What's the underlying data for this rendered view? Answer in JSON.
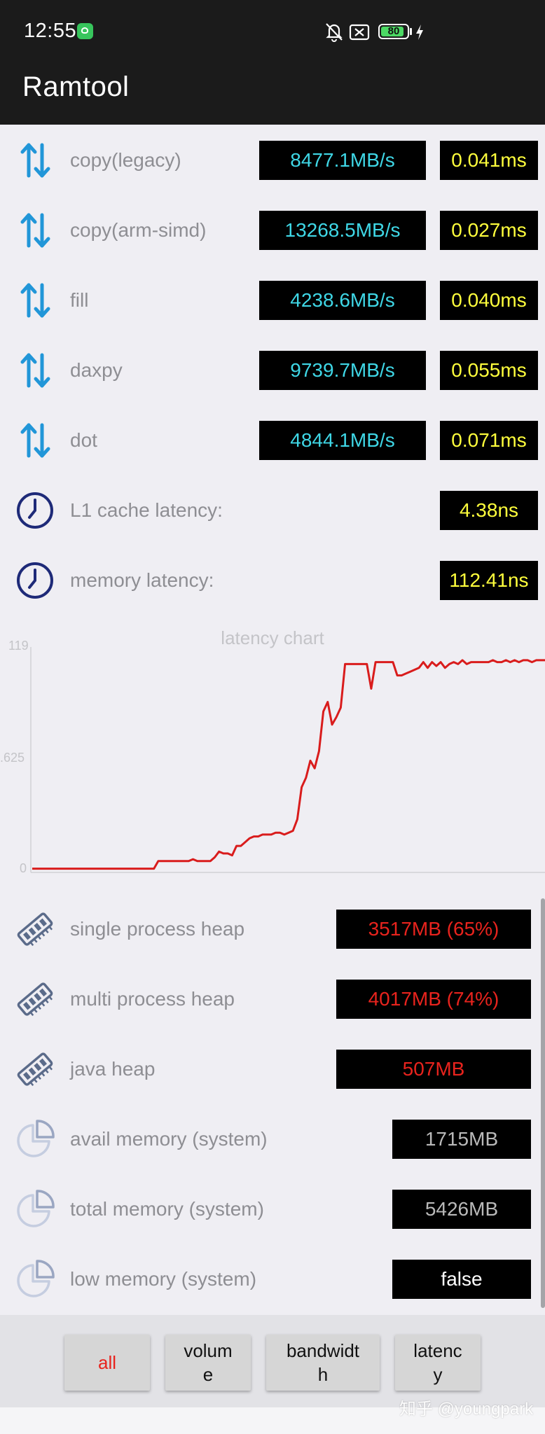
{
  "status": {
    "time": "12:55",
    "battery": "80"
  },
  "app": {
    "title": "Ramtool"
  },
  "bandwidth": [
    {
      "label": "copy(legacy)",
      "speed": "8477.1MB/s",
      "time": "0.041ms"
    },
    {
      "label": "copy(arm-simd)",
      "speed": "13268.5MB/s",
      "time": "0.027ms"
    },
    {
      "label": "fill",
      "speed": "4238.6MB/s",
      "time": "0.040ms"
    },
    {
      "label": "daxpy",
      "speed": "9739.7MB/s",
      "time": "0.055ms"
    },
    {
      "label": "dot",
      "speed": "4844.1MB/s",
      "time": "0.071ms"
    }
  ],
  "latency": [
    {
      "label": "L1 cache latency:",
      "value": "4.38ns"
    },
    {
      "label": "memory latency:",
      "value": "112.41ns"
    }
  ],
  "chart_data": {
    "type": "line",
    "title": "latency chart",
    "y_ticks": [
      "0",
      ".625",
      "119"
    ],
    "ylim": [
      0,
      119
    ],
    "color": "#d91c1c",
    "values": [
      2,
      2,
      2,
      2,
      2,
      2,
      2,
      2,
      2,
      2,
      2,
      2,
      2,
      2,
      2,
      2,
      2,
      2,
      2,
      2,
      2,
      2,
      2,
      2,
      2,
      2,
      2,
      2,
      2,
      6,
      6,
      6,
      6,
      6,
      6,
      6,
      6,
      7,
      6,
      6,
      6,
      6,
      8,
      11,
      10,
      10,
      9,
      14,
      14,
      16,
      18,
      19,
      19,
      20,
      20,
      20,
      21,
      21,
      20,
      21,
      22,
      28,
      45,
      50,
      59,
      55,
      64,
      85,
      90,
      78,
      82,
      87,
      110,
      110,
      110,
      110,
      110,
      110,
      97,
      111,
      111,
      111,
      111,
      111,
      104,
      104,
      105,
      106,
      107,
      108,
      111,
      108,
      111,
      109,
      111,
      108,
      110,
      111,
      110,
      112,
      110,
      111,
      111,
      111,
      111,
      111,
      112,
      111,
      111,
      112,
      111,
      112,
      111,
      112,
      112,
      111,
      112,
      112,
      112
    ]
  },
  "memory": [
    {
      "label": "single process heap",
      "value": "3517MB (65%)"
    },
    {
      "label": "multi process heap",
      "value": "4017MB (74%)"
    },
    {
      "label": "java heap",
      "value": "507MB"
    },
    {
      "label": "avail memory (system)",
      "value": "1715MB"
    },
    {
      "label": "total memory (system)",
      "value": "5426MB"
    },
    {
      "label": "low memory (system)",
      "value": "false"
    }
  ],
  "tabs": [
    {
      "label": "all",
      "active": true
    },
    {
      "label": "volum\ne"
    },
    {
      "label": "bandwidt\nh"
    },
    {
      "label": "latenc\ny"
    }
  ],
  "watermark": "知乎 @youngpark",
  "colors": {
    "cyan": "#3fd7e6",
    "yellow": "#ffff3c",
    "red": "#e8231d",
    "blue_icon": "#2196d8",
    "navy_icon": "#1e2a78"
  }
}
